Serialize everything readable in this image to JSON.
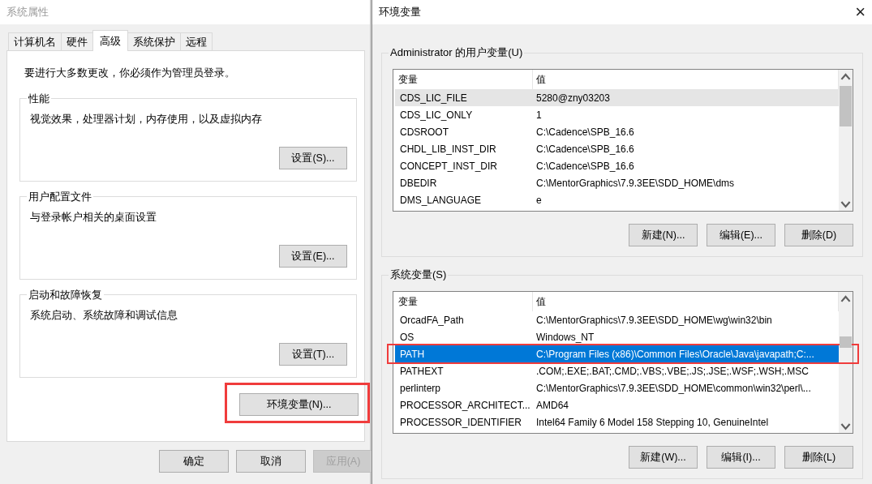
{
  "system_properties": {
    "title": "系统属性",
    "tabs": [
      {
        "label": "计算机名",
        "selected": false
      },
      {
        "label": "硬件",
        "selected": false
      },
      {
        "label": "高级",
        "selected": true
      },
      {
        "label": "系统保护",
        "selected": false
      },
      {
        "label": "远程",
        "selected": false
      }
    ],
    "notice": "要进行大多数更改，你必须作为管理员登录。",
    "groups": [
      {
        "title": "性能",
        "description": "视觉效果，处理器计划，内存使用，以及虚拟内存",
        "button": "设置(S)..."
      },
      {
        "title": "用户配置文件",
        "description": "与登录帐户相关的桌面设置",
        "button": "设置(E)..."
      },
      {
        "title": "启动和故障恢复",
        "description": "系统启动、系统故障和调试信息",
        "button": "设置(T)..."
      }
    ],
    "env_button": {
      "label": "环境变量(N)...",
      "highlighted": true
    },
    "footer_buttons": [
      {
        "label": "确定",
        "disabled": false
      },
      {
        "label": "取消",
        "disabled": false
      },
      {
        "label": "应用(A)",
        "disabled": true
      }
    ]
  },
  "environment_variables": {
    "title": "环境变量",
    "close": "×",
    "sections": [
      {
        "title": "Administrator 的用户变量(U)",
        "focused": false,
        "columns": [
          "变量",
          "值"
        ],
        "rows": [
          {
            "name": "CDS_LIC_FILE",
            "value": "5280@zny03203",
            "selected": true,
            "highlighted": false
          },
          {
            "name": "CDS_LIC_ONLY",
            "value": "1",
            "selected": false,
            "highlighted": false
          },
          {
            "name": "CDSROOT",
            "value": "C:\\Cadence\\SPB_16.6",
            "selected": false,
            "highlighted": false
          },
          {
            "name": "CHDL_LIB_INST_DIR",
            "value": "C:\\Cadence\\SPB_16.6",
            "selected": false,
            "highlighted": false
          },
          {
            "name": "CONCEPT_INST_DIR",
            "value": "C:\\Cadence\\SPB_16.6",
            "selected": false,
            "highlighted": false
          },
          {
            "name": "DBEDIR",
            "value": "C:\\MentorGraphics\\7.9.3EE\\SDD_HOME\\dms",
            "selected": false,
            "highlighted": false
          },
          {
            "name": "DMS_LANGUAGE",
            "value": "e",
            "selected": false,
            "highlighted": false
          }
        ],
        "buttons": [
          "新建(N)...",
          "编辑(E)...",
          "删除(D)"
        ]
      },
      {
        "title": "系统变量(S)",
        "focused": true,
        "columns": [
          "变量",
          "值"
        ],
        "rows": [
          {
            "name": "OrcadFA_Path",
            "value": "C:\\MentorGraphics\\7.9.3EE\\SDD_HOME\\wg\\win32\\bin",
            "selected": false,
            "highlighted": false
          },
          {
            "name": "OS",
            "value": "Windows_NT",
            "selected": false,
            "highlighted": false
          },
          {
            "name": "PATH",
            "value": "C:\\Program Files (x86)\\Common Files\\Oracle\\Java\\javapath;C:...",
            "selected": true,
            "highlighted": true
          },
          {
            "name": "PATHEXT",
            "value": ".COM;.EXE;.BAT;.CMD;.VBS;.VBE;.JS;.JSE;.WSF;.WSH;.MSC",
            "selected": false,
            "highlighted": false
          },
          {
            "name": "perlinterp",
            "value": "C:\\MentorGraphics\\7.9.3EE\\SDD_HOME\\common\\win32\\perl\\...",
            "selected": false,
            "highlighted": false
          },
          {
            "name": "PROCESSOR_ARCHITECT...",
            "value": "AMD64",
            "selected": false,
            "highlighted": false
          },
          {
            "name": "PROCESSOR_IDENTIFIER",
            "value": "Intel64 Family 6 Model 158 Stepping 10, GenuineIntel",
            "selected": false,
            "highlighted": false
          }
        ],
        "buttons": [
          "新建(W)...",
          "编辑(I)...",
          "删除(L)"
        ]
      }
    ]
  }
}
